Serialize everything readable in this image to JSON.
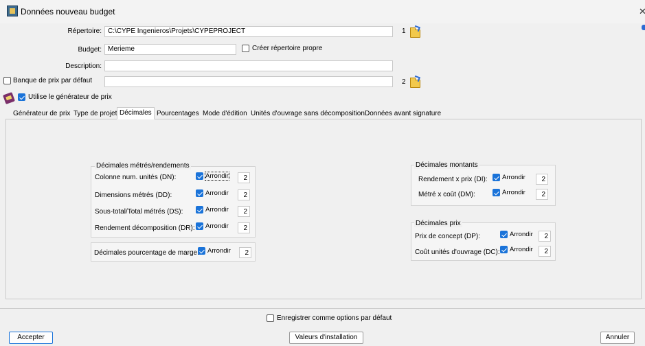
{
  "window": {
    "title": "Données nouveau budget"
  },
  "form": {
    "repertoire_label": "Répertoire:",
    "repertoire_value": "C:\\CYPE Ingenieros\\Projets\\CYPEPROJECT",
    "repertoire_num": "1",
    "budget_label": "Budget:",
    "budget_value": "Merieme",
    "creer_label": "Créer répertoire propre",
    "description_label": "Description:",
    "description_value": "",
    "banque_label": "Banque de prix par défaut",
    "banque_value": "",
    "banque_num": "2",
    "generateur_label": "Utilise le générateur de prix"
  },
  "tabs": [
    {
      "label": "Générateur de prix"
    },
    {
      "label": "Type de projet"
    },
    {
      "label": "Décimales"
    },
    {
      "label": "Pourcentages"
    },
    {
      "label": "Mode d'édition"
    },
    {
      "label": "Unités d'ouvrage sans décomposition"
    },
    {
      "label": "Données avant signature"
    }
  ],
  "decimales": {
    "metres": {
      "title": "Décimales métrés/rendements",
      "rows": [
        {
          "label": "Colonne num. unités (DN):",
          "arrondir": "Arrondir",
          "value": "2"
        },
        {
          "label": "Dimensions métrés (DD):",
          "arrondir": "Arrondir",
          "value": "2"
        },
        {
          "label": "Sous-total/Total métrés (DS):",
          "arrondir": "Arrondir",
          "value": "2"
        },
        {
          "label": "Rendement décomposition (DR):",
          "arrondir": "Arrondir",
          "value": "2"
        }
      ]
    },
    "marge": {
      "label": "Décimales pourcentage de marge:",
      "arrondir": "Arrondir",
      "value": "2"
    },
    "montants": {
      "title": "Décimales montants",
      "rows": [
        {
          "label": "Rendement x prix (DI):",
          "arrondir": "Arrondir",
          "value": "2"
        },
        {
          "label": "Métré x coût (DM):",
          "arrondir": "Arrondir",
          "value": "2"
        }
      ]
    },
    "prix": {
      "title": "Décimales prix",
      "rows": [
        {
          "label": "Prix de concept (DP):",
          "arrondir": "Arrondir",
          "value": "2"
        },
        {
          "label": "Coût unités d'ouvrage (DC):",
          "arrondir": "Arrondir",
          "value": "2"
        }
      ]
    }
  },
  "footer": {
    "save_default_label": "Enregistrer comme options par défaut",
    "accept": "Accepter",
    "install_values": "Valeurs d'installation",
    "cancel": "Annuler"
  },
  "colors": {
    "accent": "#1a73d9",
    "background": "#f0f0f0"
  },
  "icons": [
    "app-icon",
    "close-icon",
    "folder-open-icon",
    "book-icon",
    "checkbox-icon"
  ]
}
